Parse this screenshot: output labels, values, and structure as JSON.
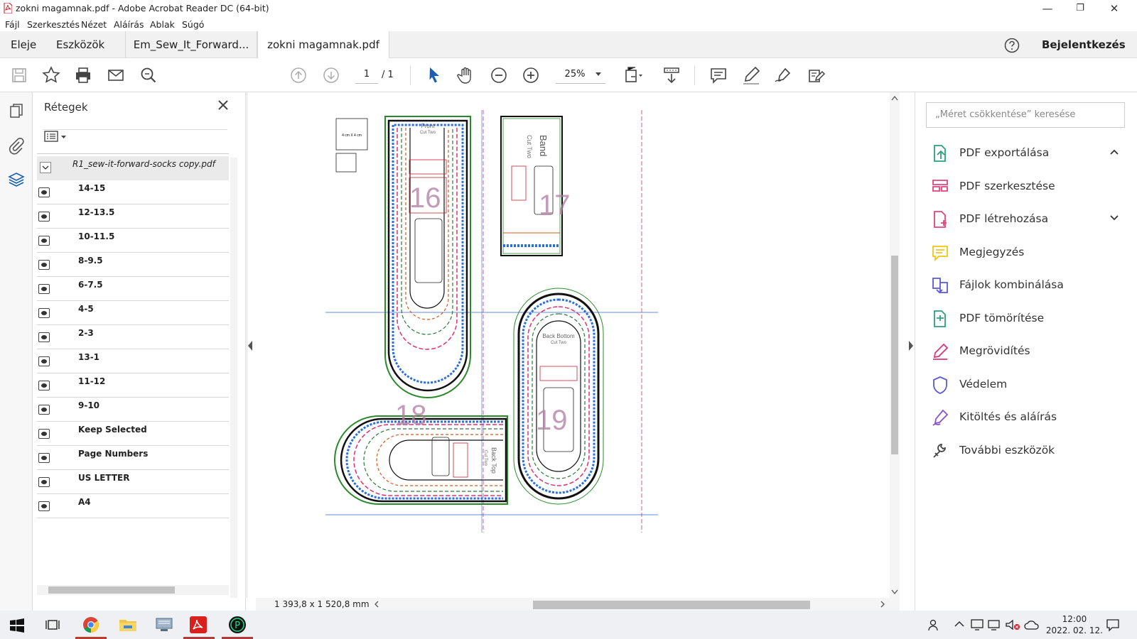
{
  "window": {
    "title": "zokni magamnak.pdf - Adobe Acrobat Reader DC (64-bit)"
  },
  "menu": [
    "Fájl",
    "Szerkesztés",
    "Nézet",
    "Aláírás",
    "Ablak",
    "Súgó"
  ],
  "tabs": {
    "home": "Eleje",
    "tools": "Eszközök",
    "doc1": "Em_Sew_It_Forward...",
    "doc2": "zokni magamnak.pdf",
    "close": "×",
    "signin": "Bejelentkezés"
  },
  "toolbar": {
    "page_current": "1",
    "page_total": "/ 1",
    "zoom": "25%"
  },
  "layers_panel": {
    "title": "Rétegek",
    "root": "R1_sew-it-forward-socks copy.pdf",
    "items": [
      "14-15",
      "12-13.5",
      "10-11.5",
      "8-9.5",
      "6-7.5",
      "4-5",
      "2-3",
      "13-1",
      "11-12",
      "9-10",
      "Keep Selected",
      "Page Numbers",
      "US LETTER",
      "A4"
    ]
  },
  "pattern": {
    "front": "Front",
    "front_sub": "Cut Two",
    "band": "Band",
    "band_sub": "Cut Two",
    "back_bottom": "Back Bottom",
    "back_bottom_sub": "Cut Two",
    "back_top": "Back Top",
    "back_top_sub": "Cut Two",
    "size_box": "4 cm X 4 cm",
    "page_nums": [
      "16",
      "17",
      "18",
      "19"
    ]
  },
  "status": {
    "page_size": "1 393,8 x 1 520,8 mm"
  },
  "right_panel": {
    "search_placeholder": "„Méret csökkentése” keresése",
    "tools": [
      {
        "label": "PDF exportálása",
        "icon": "export-pdf-icon",
        "color": "#2aa17c"
      },
      {
        "label": "PDF szerkesztése",
        "icon": "edit-pdf-icon",
        "color": "#e0467c"
      },
      {
        "label": "PDF létrehozása",
        "icon": "create-pdf-icon",
        "color": "#e0467c"
      },
      {
        "label": "Megjegyzés",
        "icon": "comment-icon",
        "color": "#f0c419"
      },
      {
        "label": "Fájlok kombinálása",
        "icon": "combine-files-icon",
        "color": "#5a5ad6"
      },
      {
        "label": "PDF tömörítése",
        "icon": "compress-pdf-icon",
        "color": "#2aa17c"
      },
      {
        "label": "Megrövidítés",
        "icon": "redact-icon",
        "color": "#d9367a"
      },
      {
        "label": "Védelem",
        "icon": "protect-shield-icon",
        "color": "#5a5ad6"
      },
      {
        "label": "Kitöltés és aláírás",
        "icon": "fill-sign-icon",
        "color": "#8a55c9"
      },
      {
        "label": "További eszközök",
        "icon": "more-tools-icon",
        "color": "#444444"
      }
    ]
  },
  "taskbar": {
    "time": "12:00",
    "date": "2022. 02. 12."
  }
}
